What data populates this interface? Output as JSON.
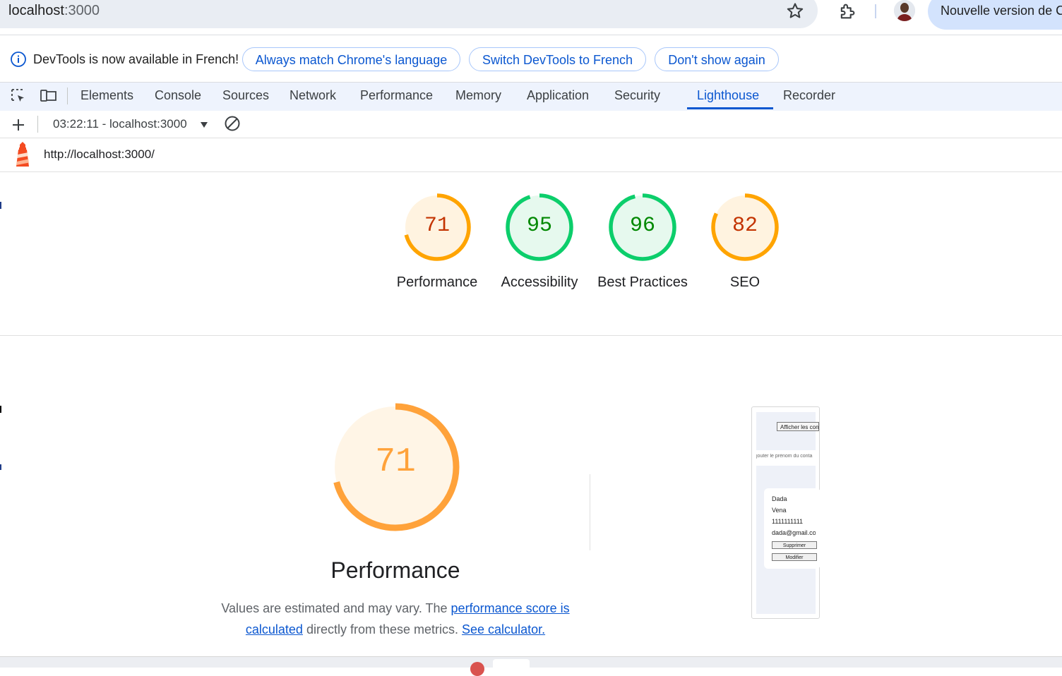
{
  "browser": {
    "url_host": "localhost",
    "url_port": ":3000",
    "update_button": "Nouvelle version de C"
  },
  "infobar": {
    "message": "DevTools is now available in French!",
    "buttons": [
      "Always match Chrome's language",
      "Switch DevTools to French",
      "Don't show again"
    ]
  },
  "tabs": [
    {
      "label": "Elements"
    },
    {
      "label": "Console"
    },
    {
      "label": "Sources"
    },
    {
      "label": "Network"
    },
    {
      "label": "Performance"
    },
    {
      "label": "Memory"
    },
    {
      "label": "Application"
    },
    {
      "label": "Security"
    },
    {
      "label": "Lighthouse",
      "active": true
    },
    {
      "label": "Recorder"
    }
  ],
  "toolbar": {
    "report_select": "03:22:11 - localhost:3000"
  },
  "report": {
    "url": "http://localhost:3000/"
  },
  "scores": [
    {
      "label": "Performance",
      "value": "71",
      "score": 0.71,
      "color": "#ffa400",
      "text_color": "#c33300",
      "bg": "#fff3e0"
    },
    {
      "label": "Accessibility",
      "value": "95",
      "score": 0.95,
      "color": "#0cce6b",
      "text_color": "#008800",
      "bg": "#e6f9ee"
    },
    {
      "label": "Best Practices",
      "value": "96",
      "score": 0.96,
      "color": "#0cce6b",
      "text_color": "#008800",
      "bg": "#e6f9ee"
    },
    {
      "label": "SEO",
      "value": "82",
      "score": 0.82,
      "color": "#ffa400",
      "text_color": "#c33300",
      "bg": "#fff3e0"
    }
  ],
  "performance": {
    "score": "71",
    "score_fraction": 0.71,
    "title": "Performance",
    "desc_prefix": "Values are estimated and may vary. The ",
    "link1": "performance score is calculated",
    "desc_middle": " directly from these metrics. ",
    "link2": "See calculator."
  },
  "thumbnail": {
    "button": "Afficher les con",
    "input_placeholder": "jouter le prénom du conta",
    "contact": [
      "Dada",
      "Vena",
      "1111111111",
      "dada@gmail.co"
    ],
    "buttons": [
      "Supprimer",
      "Modifier"
    ]
  },
  "colors": {
    "accent": "#0b57d0",
    "orange": "#ffa400",
    "green": "#0cce6b"
  }
}
